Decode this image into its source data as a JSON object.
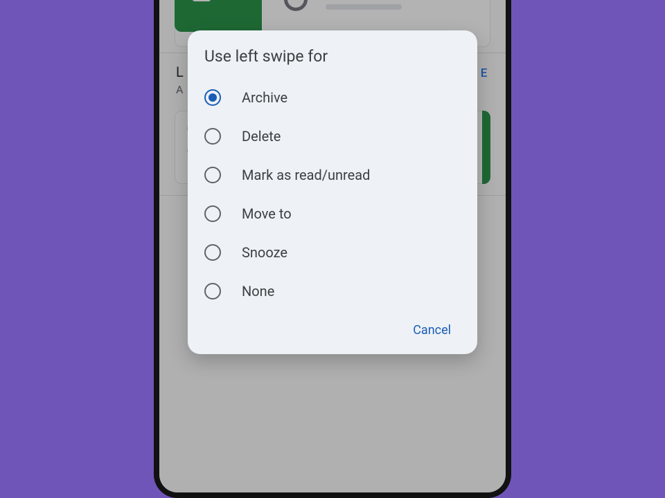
{
  "background": {
    "settingLabelPartial": "L",
    "settingValuePartial": "A",
    "changeButtonPartial": "E"
  },
  "dialog": {
    "title": "Use left swipe for",
    "options": [
      {
        "label": "Archive",
        "selected": true
      },
      {
        "label": "Delete",
        "selected": false
      },
      {
        "label": "Mark as read/unread",
        "selected": false
      },
      {
        "label": "Move to",
        "selected": false
      },
      {
        "label": "Snooze",
        "selected": false
      },
      {
        "label": "None",
        "selected": false
      }
    ],
    "cancel": "Cancel"
  }
}
